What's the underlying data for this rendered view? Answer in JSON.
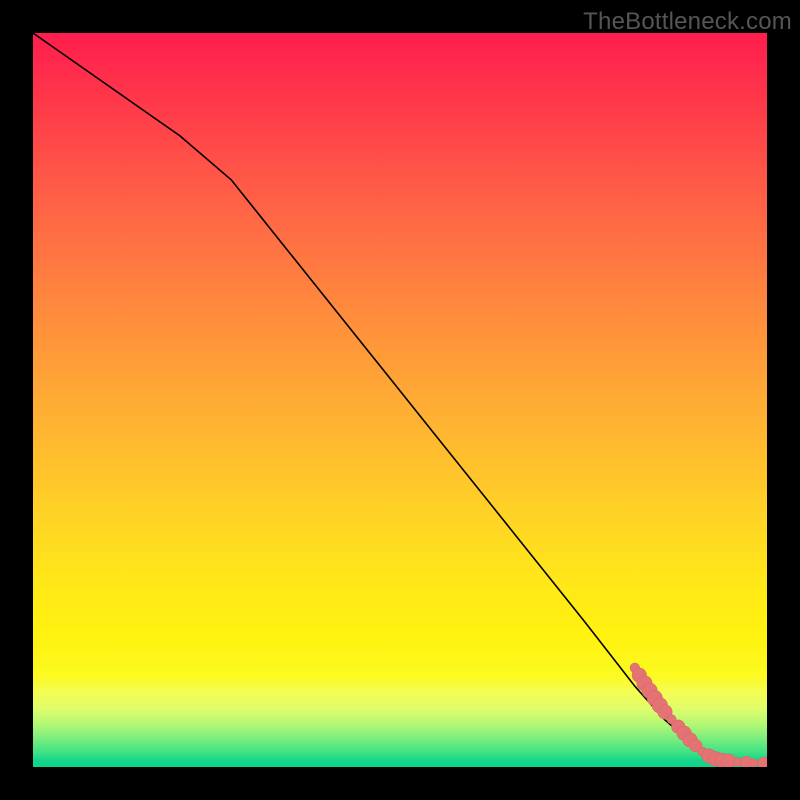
{
  "watermark": "TheBottleneck.com",
  "colors": {
    "frame": "#000000",
    "curve": "#000000",
    "marker_fill": "#e57373",
    "marker_stroke": "#d46a6a"
  },
  "chart_data": {
    "type": "line",
    "title": "",
    "xlabel": "",
    "ylabel": "",
    "xlim": [
      0,
      100
    ],
    "ylim": [
      0,
      100
    ],
    "grid": false,
    "legend": false,
    "series": [
      {
        "name": "curve",
        "style": "line",
        "x": [
          0,
          10,
          20,
          27,
          35,
          45,
          55,
          65,
          75,
          82,
          86,
          90,
          92,
          94,
          96,
          98,
          100
        ],
        "y": [
          100,
          93,
          86,
          80,
          70,
          57.5,
          45,
          32.5,
          20,
          11,
          6.5,
          3.0,
          2.0,
          1.4,
          1.0,
          0.7,
          0.5
        ]
      },
      {
        "name": "markers",
        "style": "scatter",
        "points": [
          {
            "x": 82.0,
            "y": 13.5,
            "r": 2.0
          },
          {
            "x": 82.6,
            "y": 12.5,
            "r": 3.0
          },
          {
            "x": 83.3,
            "y": 11.4,
            "r": 3.2
          },
          {
            "x": 84.0,
            "y": 10.4,
            "r": 3.2
          },
          {
            "x": 84.7,
            "y": 9.4,
            "r": 3.2
          },
          {
            "x": 85.4,
            "y": 8.4,
            "r": 3.2
          },
          {
            "x": 86.1,
            "y": 7.5,
            "r": 3.0
          },
          {
            "x": 87.0,
            "y": 6.5,
            "r": 1.9
          },
          {
            "x": 87.9,
            "y": 5.5,
            "r": 2.8
          },
          {
            "x": 88.7,
            "y": 4.6,
            "r": 3.0
          },
          {
            "x": 89.5,
            "y": 3.7,
            "r": 3.0
          },
          {
            "x": 90.3,
            "y": 2.9,
            "r": 2.6
          },
          {
            "x": 91.2,
            "y": 2.1,
            "r": 1.9
          },
          {
            "x": 92.1,
            "y": 1.5,
            "r": 3.0
          },
          {
            "x": 93.0,
            "y": 1.1,
            "r": 3.0
          },
          {
            "x": 93.9,
            "y": 0.9,
            "r": 3.0
          },
          {
            "x": 94.8,
            "y": 0.8,
            "r": 3.0
          },
          {
            "x": 96.0,
            "y": 0.7,
            "r": 1.8
          },
          {
            "x": 97.2,
            "y": 0.6,
            "r": 2.6
          },
          {
            "x": 98.2,
            "y": 0.55,
            "r": 1.8
          },
          {
            "x": 99.6,
            "y": 0.5,
            "r": 2.6
          }
        ]
      }
    ]
  }
}
